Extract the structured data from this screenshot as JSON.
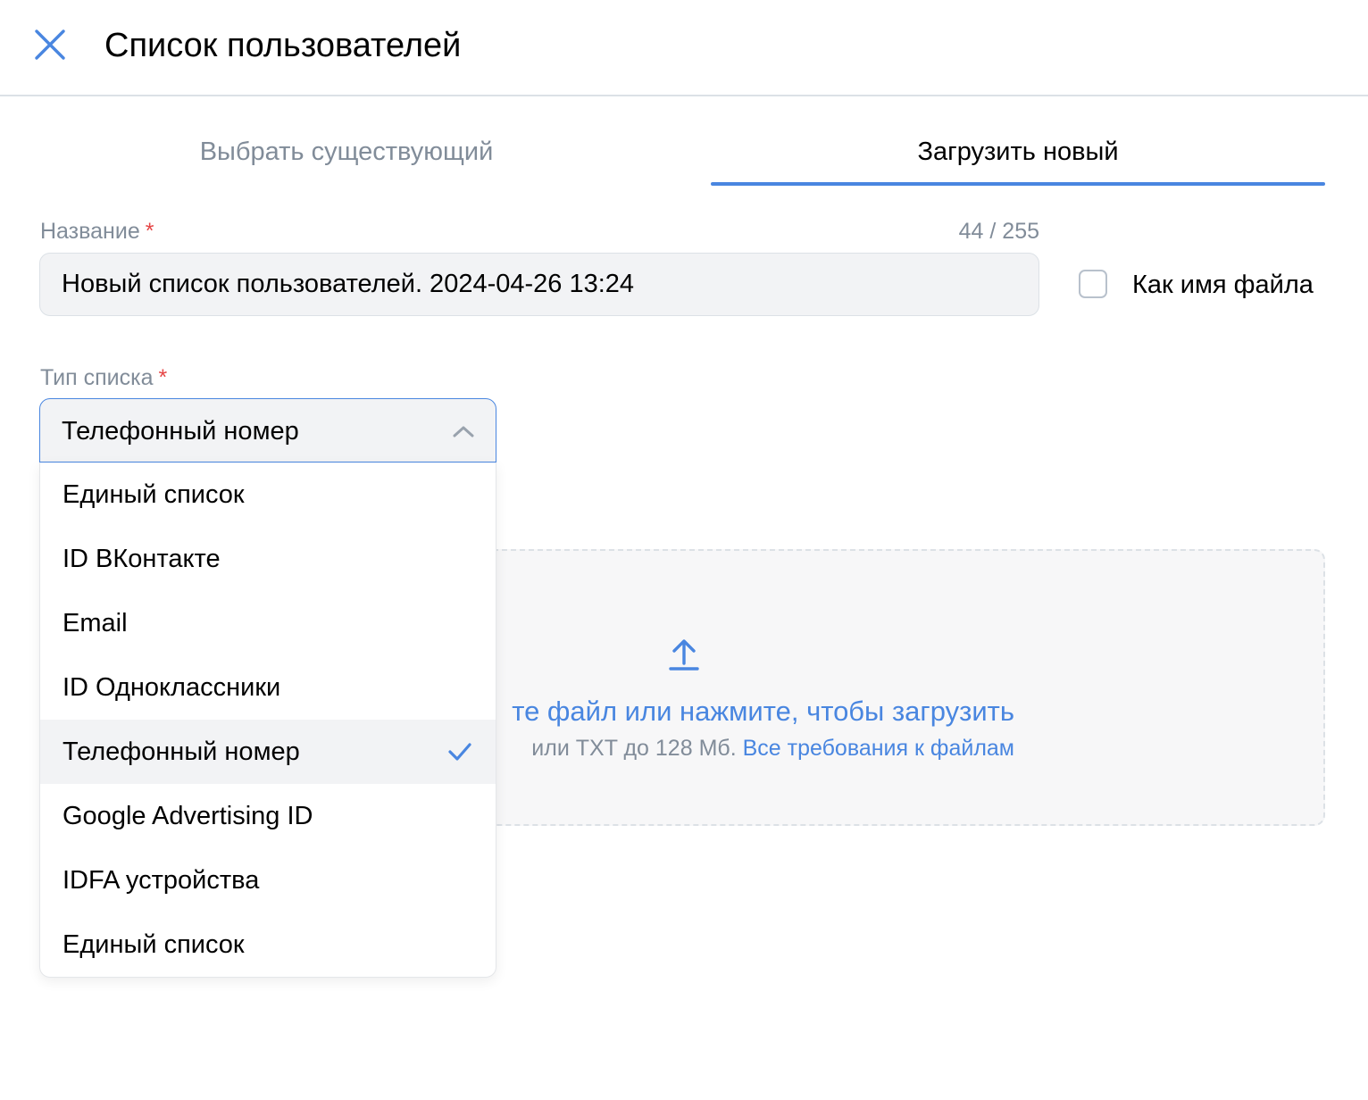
{
  "header": {
    "title": "Список пользователей",
    "close_icon": "close-icon"
  },
  "tabs": [
    {
      "label": "Выбрать существующий",
      "active": false
    },
    {
      "label": "Загрузить новый",
      "active": true
    }
  ],
  "name_field": {
    "label": "Название",
    "required_mark": "*",
    "value": "Новый список пользователей. 2024-04-26 13:24",
    "counter": "44 / 255"
  },
  "filename_checkbox": {
    "label": "Как имя файла",
    "checked": false
  },
  "type_field": {
    "label": "Тип списка",
    "required_mark": "*",
    "selected": "Телефонный номер",
    "options": [
      {
        "label": "Единый список",
        "selected": false
      },
      {
        "label": "ID ВКонтакте",
        "selected": false
      },
      {
        "label": "Email",
        "selected": false
      },
      {
        "label": "ID Одноклассники",
        "selected": false
      },
      {
        "label": "Телефонный номер",
        "selected": true
      },
      {
        "label": "Google Advertising ID",
        "selected": false
      },
      {
        "label": "IDFA устройства",
        "selected": false
      },
      {
        "label": "Единый список",
        "selected": false
      }
    ]
  },
  "upload": {
    "icon": "upload-icon",
    "main_text_visible": "те файл или нажмите, чтобы загрузить",
    "sub_text_visible": "или TXT до 128 Мб.",
    "requirements_link": "Все требования к файлам"
  },
  "colors": {
    "accent": "#4986e0",
    "muted_text": "#818c99",
    "required": "#e64646",
    "field_bg": "#f2f3f5"
  }
}
